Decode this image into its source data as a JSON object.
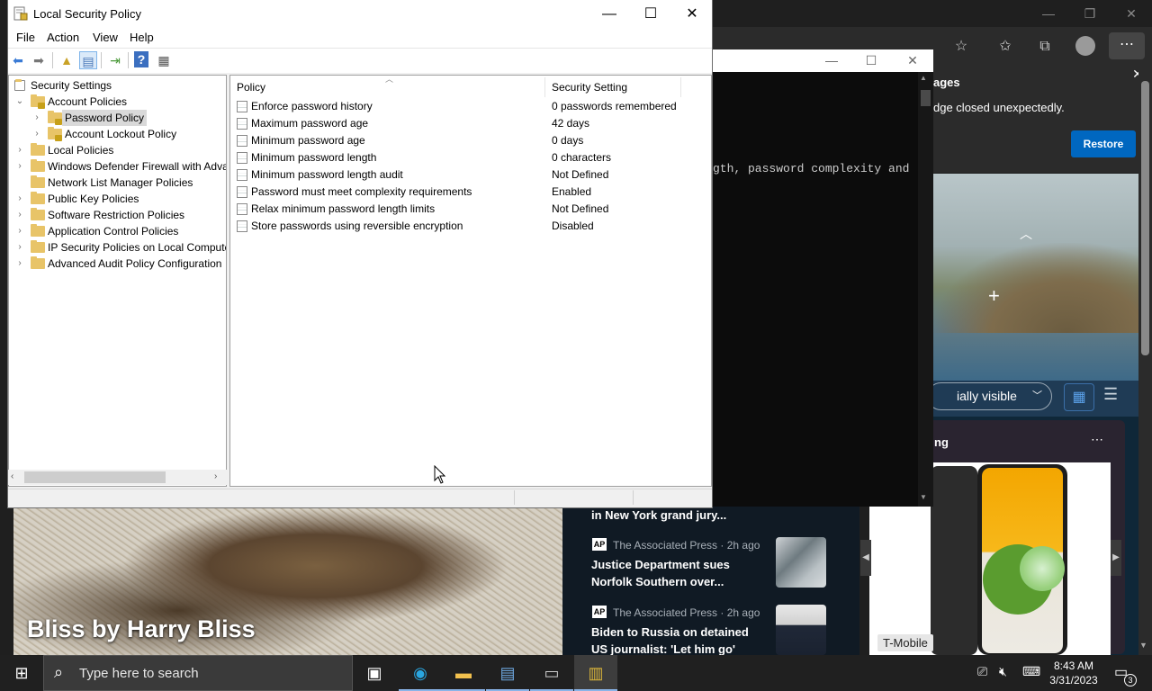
{
  "edge": {
    "restore_title": "ages",
    "restore_message": "dge closed unexpectedly.",
    "restore_button": "Restore",
    "visibility_select": "ially visible",
    "trending_title": "ng",
    "tmobile_label": "T-Mobile",
    "news": [
      {
        "headline": "in New York grand jury..."
      },
      {
        "source": "The Associated Press · 2h ago",
        "headline": "Justice Department sues Norfolk Southern over..."
      },
      {
        "source": "The Associated Press · 2h ago",
        "headline": "Biden to Russia on detained US journalist: 'Let him go'"
      }
    ],
    "comic_title": "Bliss by Harry Bliss",
    "ap_badge": "AP"
  },
  "console": {
    "text": "gth, password complexity and"
  },
  "lsp": {
    "title": "Local Security Policy",
    "menu": [
      "File",
      "Action",
      "View",
      "Help"
    ],
    "tree": [
      {
        "label": "Security Settings",
        "level": 0,
        "toggle": ""
      },
      {
        "label": "Account Policies",
        "level": 1,
        "toggle": "v"
      },
      {
        "label": "Password Policy",
        "level": 2,
        "toggle": ">",
        "selected": true
      },
      {
        "label": "Account Lockout Policy",
        "level": 2,
        "toggle": ">"
      },
      {
        "label": "Local Policies",
        "level": 1,
        "toggle": ">"
      },
      {
        "label": "Windows Defender Firewall with Adva",
        "level": 1,
        "toggle": ">"
      },
      {
        "label": "Network List Manager Policies",
        "level": 1,
        "toggle": ""
      },
      {
        "label": "Public Key Policies",
        "level": 1,
        "toggle": ">"
      },
      {
        "label": "Software Restriction Policies",
        "level": 1,
        "toggle": ">"
      },
      {
        "label": "Application Control Policies",
        "level": 1,
        "toggle": ">"
      },
      {
        "label": "IP Security Policies on Local Compute",
        "level": 1,
        "toggle": ">"
      },
      {
        "label": "Advanced Audit Policy Configuration",
        "level": 1,
        "toggle": ">"
      }
    ],
    "columns": {
      "policy": "Policy",
      "setting": "Security Setting"
    },
    "policies": [
      {
        "name": "Enforce password history",
        "value": "0 passwords remembered"
      },
      {
        "name": "Maximum password age",
        "value": "42 days"
      },
      {
        "name": "Minimum password age",
        "value": "0 days"
      },
      {
        "name": "Minimum password length",
        "value": "0 characters"
      },
      {
        "name": "Minimum password length audit",
        "value": "Not Defined"
      },
      {
        "name": "Password must meet complexity requirements",
        "value": "Enabled"
      },
      {
        "name": "Relax minimum password length limits",
        "value": "Not Defined"
      },
      {
        "name": "Store passwords using reversible encryption",
        "value": "Disabled"
      }
    ]
  },
  "taskbar": {
    "search_placeholder": "Type here to search",
    "time": "8:43 AM",
    "date": "3/31/2023",
    "notification_count": "3"
  }
}
